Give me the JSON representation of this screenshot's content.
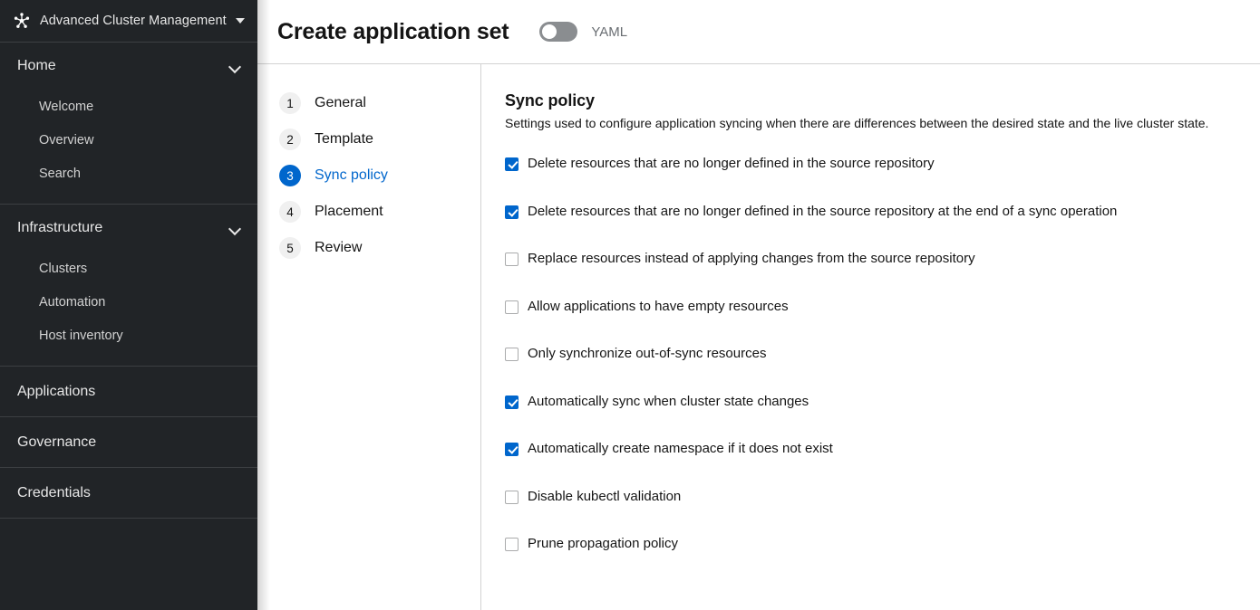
{
  "sidebar": {
    "brand": {
      "icon": "cluster-star-icon",
      "title": "Advanced Cluster Management",
      "caret": "caret-down-icon"
    },
    "groups": [
      {
        "label": "Home",
        "expanded": true,
        "items": [
          {
            "label": "Welcome"
          },
          {
            "label": "Overview"
          },
          {
            "label": "Search"
          }
        ]
      },
      {
        "label": "Infrastructure",
        "expanded": true,
        "items": [
          {
            "label": "Clusters"
          },
          {
            "label": "Automation"
          },
          {
            "label": "Host inventory"
          }
        ]
      }
    ],
    "flat_items": [
      {
        "label": "Applications"
      },
      {
        "label": "Governance"
      },
      {
        "label": "Credentials"
      }
    ]
  },
  "header": {
    "title": "Create application set",
    "yaml_toggle": {
      "label": "YAML",
      "checked": false
    }
  },
  "wizard": {
    "steps": [
      {
        "number": "1",
        "label": "General",
        "active": false
      },
      {
        "number": "2",
        "label": "Template",
        "active": false
      },
      {
        "number": "3",
        "label": "Sync policy",
        "active": true
      },
      {
        "number": "4",
        "label": "Placement",
        "active": false
      },
      {
        "number": "5",
        "label": "Review",
        "active": false
      }
    ]
  },
  "content": {
    "section_title": "Sync policy",
    "section_description": "Settings used to configure application syncing when there are differences between the desired state and the live cluster state.",
    "checkboxes": [
      {
        "label": "Delete resources that are no longer defined in the source repository",
        "checked": true
      },
      {
        "label": "Delete resources that are no longer defined in the source repository at the end of a sync operation",
        "checked": true
      },
      {
        "label": "Replace resources instead of applying changes from the source repository",
        "checked": false
      },
      {
        "label": "Allow applications to have empty resources",
        "checked": false
      },
      {
        "label": "Only synchronize out-of-sync resources",
        "checked": false
      },
      {
        "label": "Automatically sync when cluster state changes",
        "checked": true
      },
      {
        "label": "Automatically create namespace if it does not exist",
        "checked": true
      },
      {
        "label": "Disable kubectl validation",
        "checked": false
      },
      {
        "label": "Prune propagation policy",
        "checked": false
      }
    ]
  },
  "colors": {
    "sidebar_bg": "#212427",
    "accent_blue": "#0066cc",
    "divider": "#d2d2d2",
    "toggle_track": "#8a8d90"
  }
}
